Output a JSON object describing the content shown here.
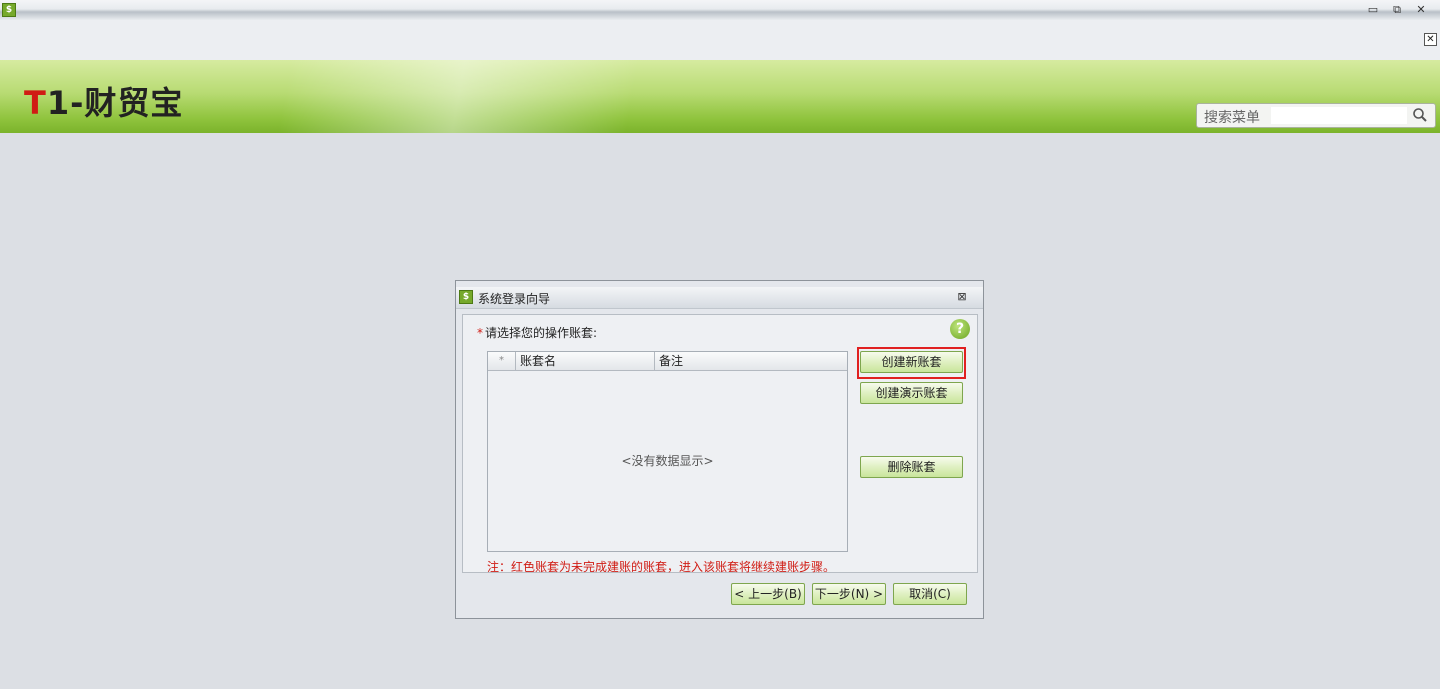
{
  "app": {
    "logo_t": "T",
    "logo_rest": "1-财贸宝"
  },
  "window": {
    "minimize": "▭",
    "restore": "⧉",
    "close": "✕",
    "inner_close": "✕"
  },
  "search": {
    "label": "搜索菜单",
    "value": "",
    "icon": "search-icon"
  },
  "dialog": {
    "title": "系统登录向导",
    "close": "⊠",
    "required_mark": "*",
    "prompt": "请选择您的操作账套:",
    "help": "?",
    "table": {
      "columns": [
        "*",
        "账套名",
        "备注"
      ],
      "rows": [],
      "empty_text": "<没有数据显示>"
    },
    "note": "注：红色账套为未完成建账的账套，进入该账套将继续建账步骤。",
    "buttons": {
      "create_new": "创建新账套",
      "create_demo": "创建演示账套",
      "delete": "删除账套",
      "prev": "< 上一步(B)",
      "next": "下一步(N) >",
      "cancel": "取消(C)"
    }
  },
  "colors": {
    "accent_green": "#90c43e",
    "logo_red": "#d01c14",
    "highlight_red": "#e02020"
  }
}
